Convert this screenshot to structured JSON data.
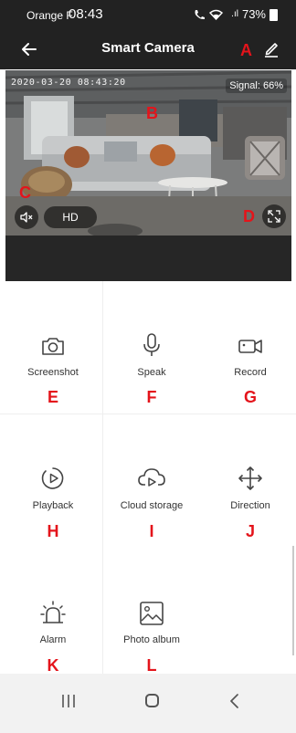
{
  "status": {
    "carrier": "Orange F",
    "time": "08:43",
    "battery": "73%",
    "signal_glyphs": "  .ıl"
  },
  "header": {
    "title": "Smart Camera"
  },
  "camera": {
    "timestamp": "2020-03-20 08:43:20",
    "signal": "Signal: 66%",
    "quality": "HD"
  },
  "annotations": {
    "a": "A",
    "b": "B",
    "c": "C",
    "d": "D",
    "e": "E",
    "f": "F",
    "g": "G",
    "h": "H",
    "i": "I",
    "j": "J",
    "k": "K",
    "l": "L"
  },
  "actions": {
    "screenshot": "Screenshot",
    "speak": "Speak",
    "record": "Record",
    "playback": "Playback",
    "cloud_storage": "Cloud storage",
    "direction": "Direction",
    "alarm": "Alarm",
    "photo_album": "Photo album"
  },
  "colors": {
    "bar_dark": "#222222",
    "annotation_red": "#e4141b",
    "icon_gray": "#444444"
  }
}
